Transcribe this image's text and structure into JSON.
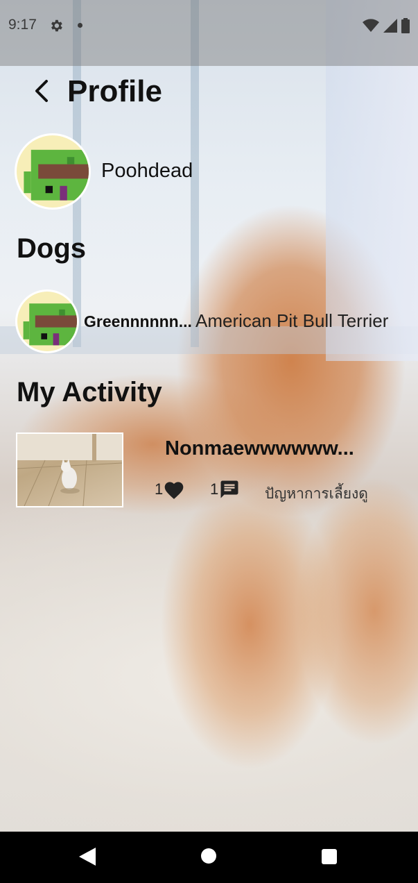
{
  "status_bar": {
    "time": "9:17",
    "icons": [
      "gear-icon",
      "dot-icon",
      "wifi-icon",
      "signal-icon",
      "battery-icon"
    ]
  },
  "header": {
    "back_icon": "chevron-left-icon",
    "title": "Profile"
  },
  "profile": {
    "username": "Poohdead"
  },
  "dogs_section": {
    "title": "Dogs",
    "items": [
      {
        "name": "Greennnnnn...",
        "breed": "American Pit Bull Terrier"
      }
    ]
  },
  "activity_section": {
    "title": "My Activity",
    "items": [
      {
        "title": "Nonmaewwwwww...",
        "likes": "1",
        "comments": "1",
        "category": "ปัญหาการเลี้ยงดู"
      }
    ]
  },
  "nav_bar": {
    "icons": [
      "back-triangle-icon",
      "home-circle-icon",
      "recents-square-icon"
    ]
  },
  "colors": {
    "text": "#111111",
    "nav_bar": "#000000",
    "avatar_green": "#5db53f",
    "avatar_brown": "#7a4a3a",
    "avatar_bg": "#f7eeb8"
  }
}
